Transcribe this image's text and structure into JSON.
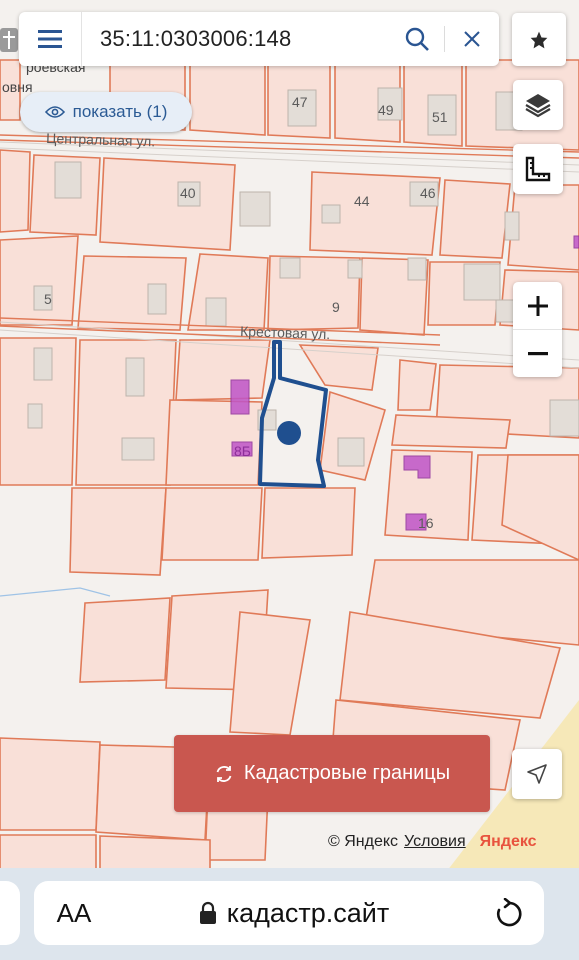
{
  "search": {
    "query": "35:11:0303006:148"
  },
  "show_button": {
    "label": "показать (1)"
  },
  "map": {
    "streets": {
      "top_partial": "роевская",
      "top_partial2": "овня",
      "central": "Центральная ул.",
      "krestovaya": "Крестовая ул."
    },
    "house_numbers": [
      "47",
      "49",
      "51",
      "40",
      "44",
      "46",
      "5",
      "9",
      "8Б",
      "16"
    ]
  },
  "cadastral_button": {
    "label": "Кадастровые границы"
  },
  "copyright": {
    "text": "© Яндекс",
    "terms": "Условия",
    "logo": "Яндекс"
  },
  "browser": {
    "text_size": "AA",
    "url": "кадастр.сайт"
  },
  "colors": {
    "parcel_fill": "#f9e0d8",
    "parcel_stroke": "#e07a58",
    "selected": "#1f4f8f",
    "building": "#e3ddd7",
    "highlight": "#bf55c8",
    "button_red": "#c9574f"
  },
  "icons": [
    "menu-icon",
    "search-icon",
    "close-icon",
    "star-icon",
    "layers-icon",
    "ruler-icon",
    "eye-icon",
    "plus-icon",
    "minus-icon",
    "refresh-icon",
    "navigate-icon",
    "lock-icon",
    "reload-icon"
  ]
}
